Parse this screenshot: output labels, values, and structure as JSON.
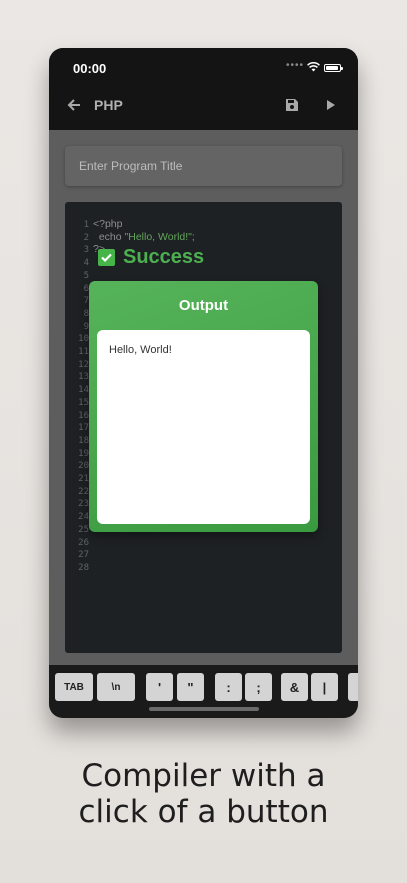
{
  "status_bar": {
    "time": "00:00"
  },
  "app_bar": {
    "title": "PHP"
  },
  "title_field": {
    "placeholder": "Enter Program Title"
  },
  "editor": {
    "line_numbers": [
      "1",
      "2",
      "3",
      "4",
      "5",
      "6",
      "7",
      "8",
      "9",
      "10",
      "11",
      "12",
      "13",
      "14",
      "15",
      "16",
      "17",
      "18",
      "19",
      "20",
      "21",
      "22",
      "23",
      "24",
      "25",
      "26",
      "27",
      "28"
    ],
    "code_lines": [
      {
        "text": "<?php"
      },
      {
        "text": "  echo ",
        "string": "\"Hello, World!\"",
        "suffix": ";"
      },
      {
        "text": "?>"
      }
    ]
  },
  "result": {
    "status": "Success",
    "status_color": "#4cb050"
  },
  "output": {
    "title": "Output",
    "text": "Hello, World!",
    "panel_color": "#46a84b"
  },
  "keyboard": {
    "keys": [
      {
        "label": "TAB"
      },
      {
        "label": "\\n"
      },
      {
        "label": "'"
      },
      {
        "label": "\""
      },
      {
        "label": ":"
      },
      {
        "label": ";"
      },
      {
        "label": "&"
      },
      {
        "label": "|"
      },
      {
        "label": ""
      }
    ]
  },
  "caption": {
    "line1": "Compiler with a",
    "line2": "click of a button"
  }
}
